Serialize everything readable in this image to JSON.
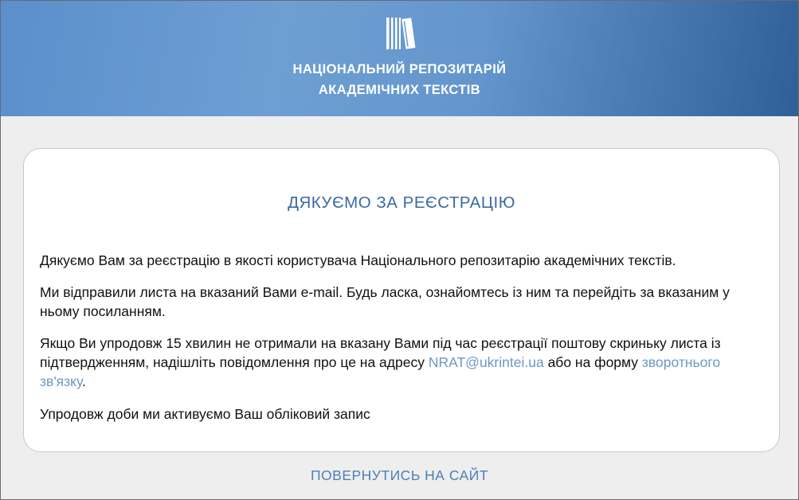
{
  "header": {
    "logo_icon": "books-icon",
    "title_line1": "НАЦІОНАЛЬНИЙ РЕПОЗИТАРІЙ",
    "title_line2": "АКАДЕМІЧНИХ ТЕКСТІВ"
  },
  "card": {
    "title": "ДЯКУЄМО ЗА РЕЄСТРАЦІЮ",
    "paragraph1": "Дякуємо Вам за реєстрацію в якості користувача Національного репозитарію академічних текстів.",
    "paragraph2": "Ми відправили листа на вказаний Вами e-mail. Будь ласка, ознайомтесь із ним та перейдіть за вказаним у ньому посиланням.",
    "paragraph3_before": "Якщо Ви упродовж 15 хвилин не отримали на вказану Вами під час реєстрації поштову скриньку листа із підтвердженням, надішліть повідомлення про це на адресу ",
    "email_link": "NRAT@ukrintei.ua",
    "paragraph3_middle": " або на форму ",
    "feedback_link": "зворотнього зв'язку",
    "paragraph3_after": ".",
    "paragraph4": "Упродовж доби ми активуємо Ваш обліковий запис"
  },
  "footer": {
    "back_link": "ПОВЕРНУТИСЬ НА САЙТ"
  },
  "colors": {
    "header_gradient_start": "#5a8fcc",
    "header_gradient_end": "#2f5f97",
    "title_color": "#3a6aa3",
    "link_color": "#6d98c6",
    "background": "#eeeeee"
  }
}
